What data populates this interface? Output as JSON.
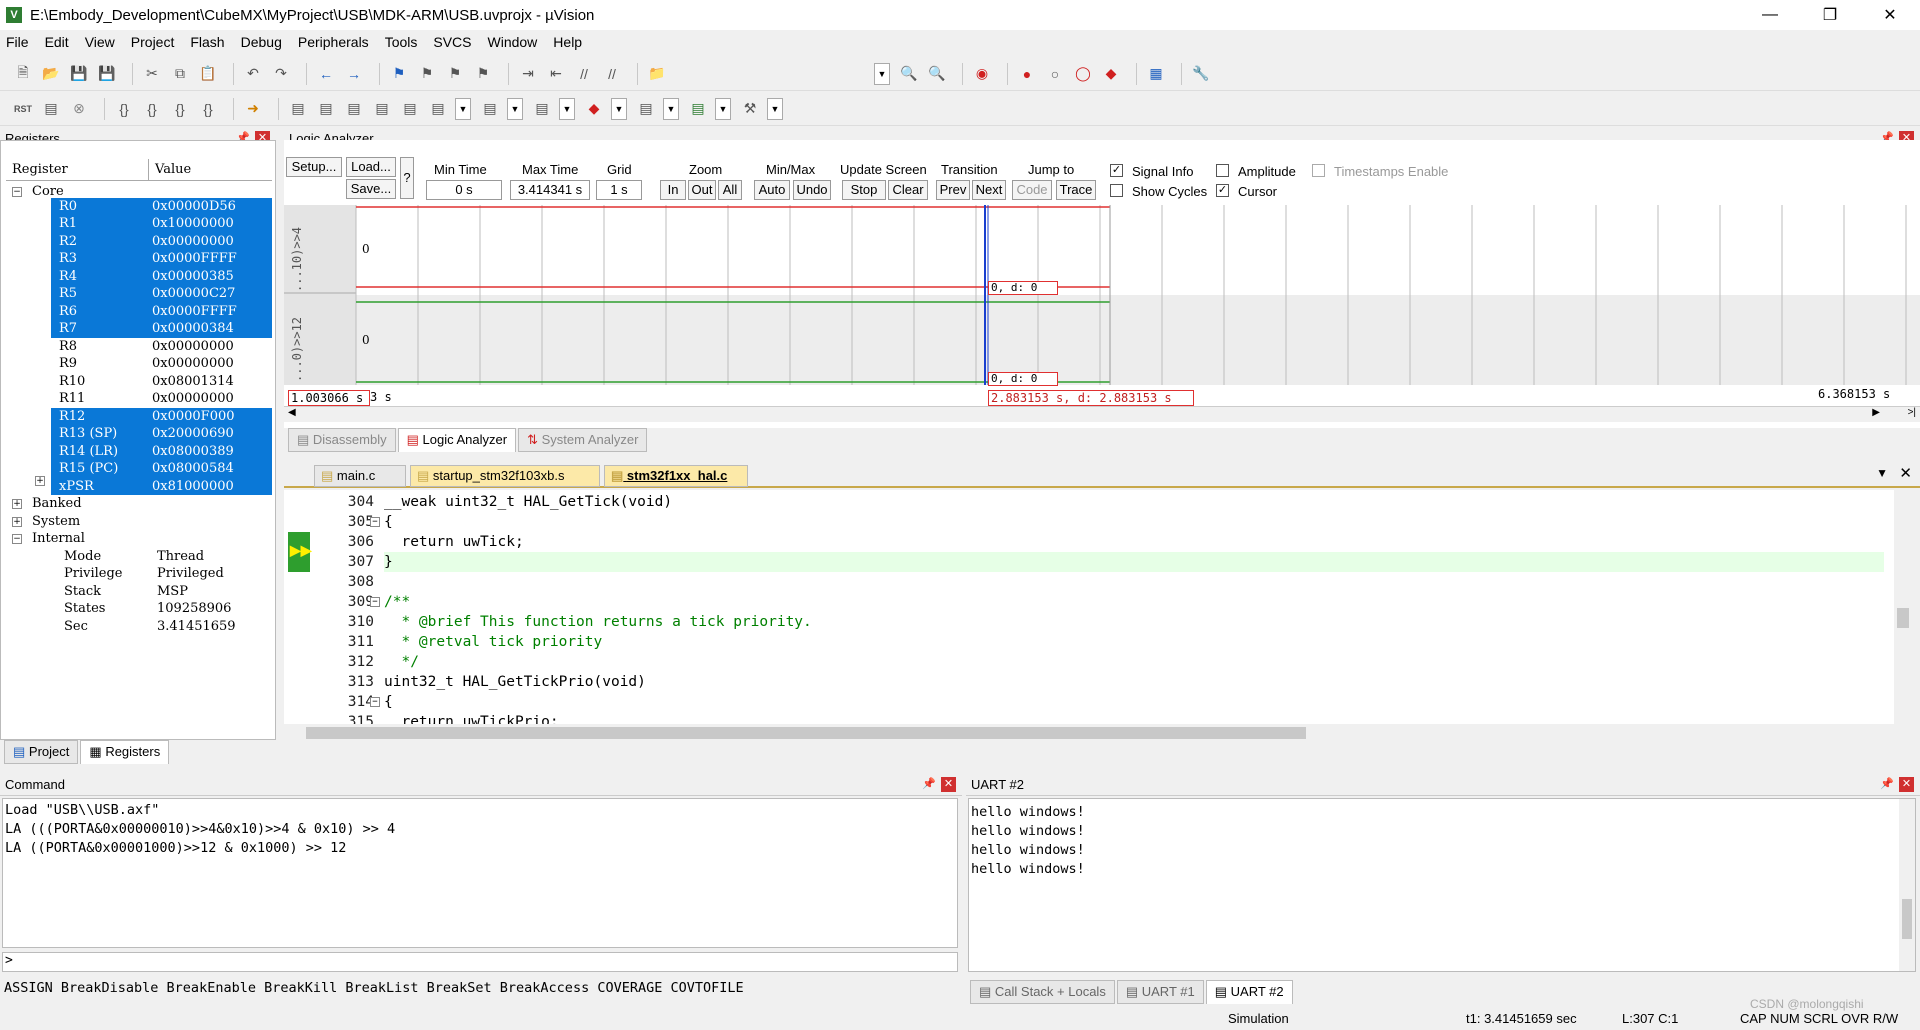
{
  "window": {
    "title": "E:\\Embody_Development\\CubeMX\\MyProject\\USB\\MDK-ARM\\USB.uvprojx - µVision"
  },
  "menu": [
    "File",
    "Edit",
    "View",
    "Project",
    "Flash",
    "Debug",
    "Peripherals",
    "Tools",
    "SVCS",
    "Window",
    "Help"
  ],
  "registers": {
    "title": "Registers",
    "col_register": "Register",
    "col_value": "Value",
    "group_core": "Core",
    "core": [
      {
        "name": "R0",
        "value": "0x00000D56",
        "sel": true
      },
      {
        "name": "R1",
        "value": "0x10000000",
        "sel": true
      },
      {
        "name": "R2",
        "value": "0x00000000",
        "sel": true
      },
      {
        "name": "R3",
        "value": "0x0000FFFF",
        "sel": true
      },
      {
        "name": "R4",
        "value": "0x00000385",
        "sel": true
      },
      {
        "name": "R5",
        "value": "0x00000C27",
        "sel": true
      },
      {
        "name": "R6",
        "value": "0x0000FFFF",
        "sel": true
      },
      {
        "name": "R7",
        "value": "0x00000384",
        "sel": true
      },
      {
        "name": "R8",
        "value": "0x00000000",
        "sel": false
      },
      {
        "name": "R9",
        "value": "0x00000000",
        "sel": false
      },
      {
        "name": "R10",
        "value": "0x08001314",
        "sel": false
      },
      {
        "name": "R11",
        "value": "0x00000000",
        "sel": false
      },
      {
        "name": "R12",
        "value": "0x0000F000",
        "sel": true
      },
      {
        "name": "R13 (SP)",
        "value": "0x20000690",
        "sel": true
      },
      {
        "name": "R14 (LR)",
        "value": "0x08000389",
        "sel": true
      },
      {
        "name": "R15 (PC)",
        "value": "0x08000584",
        "sel": true
      },
      {
        "name": "xPSR",
        "value": "0x81000000",
        "sel": true
      }
    ],
    "group_banked": "Banked",
    "group_system": "System",
    "group_internal": "Internal",
    "internal": [
      {
        "name": "Mode",
        "value": "Thread"
      },
      {
        "name": "Privilege",
        "value": "Privileged"
      },
      {
        "name": "Stack",
        "value": "MSP"
      },
      {
        "name": "States",
        "value": "109258906"
      },
      {
        "name": "Sec",
        "value": "3.41451659"
      }
    ],
    "tabs": [
      "Project",
      "Registers"
    ]
  },
  "logic_analyzer": {
    "title": "Logic Analyzer",
    "setup": "Setup...",
    "load": "Load...",
    "save": "Save...",
    "help": "?",
    "min_time_label": "Min Time",
    "min_time": "0 s",
    "max_time_label": "Max Time",
    "max_time": "3.414341 s",
    "grid_label": "Grid",
    "grid": "1 s",
    "zoom_label": "Zoom",
    "zoom_in": "In",
    "zoom_out": "Out",
    "zoom_all": "All",
    "minmax_label": "Min/Max",
    "auto": "Auto",
    "undo": "Undo",
    "update_label": "Update Screen",
    "stop": "Stop",
    "clear": "Clear",
    "transition_label": "Transition",
    "prev": "Prev",
    "next": "Next",
    "jump_label": "Jump to",
    "code": "Code",
    "trace": "Trace",
    "signal_info": "Signal Info",
    "show_cycles": "Show Cycles",
    "amplitude": "Amplitude",
    "cursor": "Cursor",
    "timestamps": "Timestamps Enable",
    "signal1_name": "...10)>>4",
    "signal2_name": "...0)>>12",
    "signal1_value": "0",
    "signal2_value": "0",
    "marker1": "0,  d: 0",
    "marker2": "0,  d: 0",
    "time_left": "1.003066 s",
    "time_left_suffix": "3 s",
    "time_cursor": "2.883153 s,  d: 2.883153 s",
    "time_right": "6.368153 s",
    "tabs": [
      "Disassembly",
      "Logic Analyzer",
      "System Analyzer"
    ]
  },
  "editor": {
    "tabs": [
      "main.c",
      "startup_stm32f103xb.s",
      "stm32f1xx_hal.c"
    ],
    "lines": [
      {
        "n": "304",
        "t": "__weak uint32_t HAL_GetTick(void)"
      },
      {
        "n": "305",
        "t": "{"
      },
      {
        "n": "306",
        "t": "  return uwTick;"
      },
      {
        "n": "307",
        "t": "}"
      },
      {
        "n": "308",
        "t": ""
      },
      {
        "n": "309",
        "t": "/**"
      },
      {
        "n": "310",
        "t": "  * @brief This function returns a tick priority."
      },
      {
        "n": "311",
        "t": "  * @retval tick priority"
      },
      {
        "n": "312",
        "t": "  */"
      },
      {
        "n": "313",
        "t": "uint32_t HAL_GetTickPrio(void)"
      },
      {
        "n": "314",
        "t": "{"
      },
      {
        "n": "315",
        "t": "  return uwTickPrio;"
      }
    ]
  },
  "command": {
    "title": "Command",
    "lines": [
      "Load \"USB\\\\USB.axf\"",
      "LA (((PORTA&0x00000010)>>4&0x10)>>4 & 0x10) >> 4",
      "LA ((PORTA&0x00001000)>>12 & 0x1000) >> 12"
    ],
    "prompt": ">",
    "hints": "ASSIGN BreakDisable BreakEnable BreakKill BreakList BreakSet BreakAccess COVERAGE COVTOFILE"
  },
  "uart": {
    "title": "UART #2",
    "lines": [
      "hello windows!",
      "hello windows!",
      "hello windows!",
      "hello windows!"
    ],
    "tabs": [
      "Call Stack + Locals",
      "UART #1",
      "UART #2"
    ]
  },
  "status": {
    "mode": "Simulation",
    "t1": "t1: 3.41451659 sec",
    "pos": "L:307 C:1",
    "keys": "CAP NUM SCRL OVR R/W",
    "watermark": "CSDN @molongqishi"
  }
}
